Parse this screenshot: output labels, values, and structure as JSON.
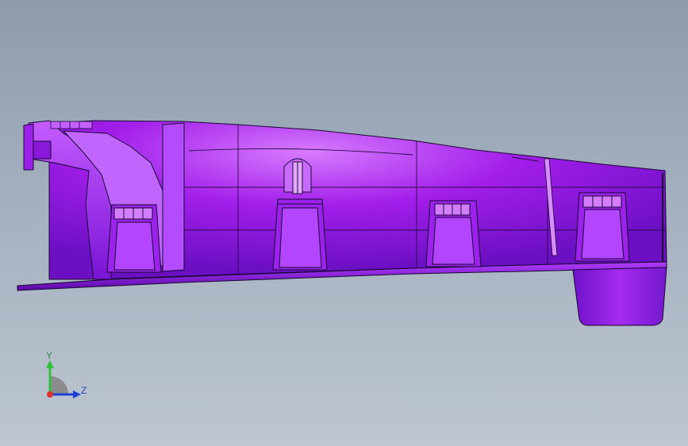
{
  "viewport": {
    "background_top": "#8d9bab",
    "background_bottom": "#bdc6d1"
  },
  "model": {
    "shading_light": "#d77bff",
    "shading_base": "#a21eea",
    "shading_dark": "#6a0fc2",
    "edge_color": "#1a0833"
  },
  "triad": {
    "y_axis": {
      "label": "Y",
      "color": "#2fbf3a"
    },
    "z_axis": {
      "label": "Z",
      "color": "#1f3fd8"
    },
    "x_axis": {
      "color": "#e0302a"
    },
    "quadrant_color": "#8c8c8c"
  }
}
